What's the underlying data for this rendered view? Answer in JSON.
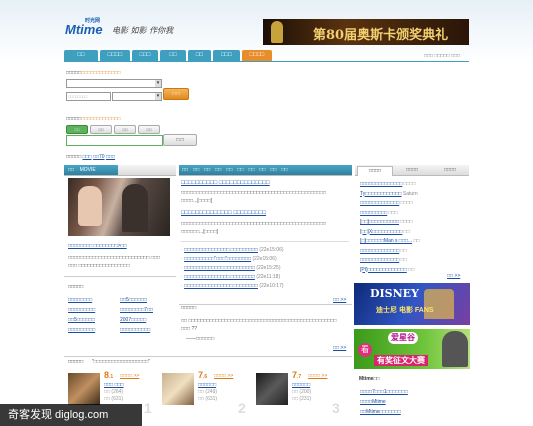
{
  "header": {
    "logo_text": "Mtime",
    "logo_cn": "时光网",
    "slogan": "电影 如影 作你我",
    "banner_text": "第80届奥斯卡颁奖典礼",
    "top_links": "□□□ □□□□□ □□□"
  },
  "nav": {
    "tabs": [
      {
        "label": "□□",
        "w": 34,
        "color": "blue"
      },
      {
        "label": "□□□□",
        "w": 30,
        "color": "blue"
      },
      {
        "label": "□□□",
        "w": 26,
        "color": "blue"
      },
      {
        "label": "□□",
        "w": 26,
        "color": "blue"
      },
      {
        "label": "□□",
        "w": 23,
        "color": "blue"
      },
      {
        "label": "□□□",
        "w": 27,
        "color": "blue"
      },
      {
        "label": "□□□□",
        "w": 30,
        "color": "orange"
      }
    ]
  },
  "search": {
    "label1": "□□□□□",
    "label1_hint": "□□□□□□□□□□□□□",
    "placeholder1": "□□□□□□□□",
    "button1": "□ □",
    "label2": "□□□□□",
    "label2_hint": "□□□□□□□□□□□□□",
    "type_buttons": [
      "□□",
      "□□",
      "□□",
      "□□"
    ],
    "button2": "□ □",
    "hot_label": "□□□□□",
    "hot_links": [
      "□□□",
      "□□70",
      "□□□"
    ]
  },
  "left_panel": {
    "tab_active": "□□",
    "tab_label": "MOVIE",
    "caption": "□□□□□□□□ □□□□□□□□>□□",
    "desc_lines": [
      "□□□□□□□□□□□□□□□□□□□□□□□□□□□ □□□",
      "□□□ □□□□□□□□□□□□□□□□□"
    ],
    "list_title": "□□□□□",
    "links_col1": [
      "□□□□□□□□",
      "□□□□□□□□□",
      "□□5□□□□□□",
      "□□□□□□□□□"
    ],
    "links_col2": [
      "□□5□□□□□□",
      "□□□□□□□□7□□",
      "2007□□□□□",
      "□□□□□□□□□□"
    ]
  },
  "center": {
    "tabs": [
      "□□",
      "□□",
      "□□",
      "□□",
      "□□",
      "□□",
      "□□",
      "□□",
      "□□",
      "□□"
    ],
    "headline1": "□□□□□□□□□□ □□□□□□□□□□□□□□",
    "body1": [
      "□□□□□□□□□□□□□□□□□□□□□□□□□□□□□□□□□□□□□□□□□□□□□□□□",
      "□□□□...[□□□□]"
    ],
    "headline2": "□□□□□□□□□□□□□□ □□□□□□□□□",
    "body2": [
      "□□□□□□□□□□□□□□□□□□□□□□□□□□□□□□□□□□□□□□□□□□□□□□□□",
      "□□□□□□...[□□□□]"
    ],
    "news": [
      {
        "title": "□□□□□□□□□□□□□□□ □□□□□□□□□",
        "date": "(22e15:06)"
      },
      {
        "title": "□□□□□□□□□□\"□□□\"□□□□□□□□",
        "date": "(22e15:06)"
      },
      {
        "title": "□□□□□□□□□□□□□ □□□□□□□□□□",
        "date": "(22e15:25)"
      },
      {
        "title": "□□□□□□□□□□□□□□□ □□□□□□□□",
        "date": "(22e11:18)"
      },
      {
        "title": "□□□□□□□□□□□□□□□□ □□□□□□□□",
        "date": "(22e10:17)"
      }
    ],
    "more": "□□ >>",
    "review_title": "□□□□□",
    "review_lines": [
      "□□ □□□□□□□□□□□□□□□□□□□□□□□□□□□□□□□□□□□□□□□□□□□□□□□□□",
      "□□□ ??",
      "——□□□□□□"
    ],
    "more2": "□□ >>"
  },
  "right": {
    "tabs": [
      "□□□□",
      "□□□□",
      "□□□□"
    ],
    "items": [
      {
        "link": "□□□□□□□□□□□□□□",
        "extra": "□□□□"
      },
      {
        "link": "Ty□□□□□□□□□□□□",
        "extra": "Saturn"
      },
      {
        "link": "□□□□□□□□□□□□□",
        "extra": "□□□□"
      },
      {
        "link": "□□□□□□□□□",
        "extra": "□□□"
      },
      {
        "link": "[□□]□□□□□□□□□□",
        "extra": "□□□□"
      },
      {
        "link": "[□□]X□□□□□□□□□□",
        "extra": "□□"
      },
      {
        "link": "[□]□□□□□□Man s □□□...",
        "extra": "□□"
      },
      {
        "link": "□□□□□□□□□□□□□",
        "extra": "□□"
      },
      {
        "link": "□□□□□□□□□□□□□",
        "extra": "□□"
      },
      {
        "link": "[PI]□□□□□□□□□□□□□",
        "extra": "□□"
      }
    ],
    "more": "□□ >>",
    "ad1_text": "DISNEY",
    "ad2_text": "爱星谷",
    "section_title": "Mtime□□",
    "bottom_links": [
      "□□□□7□□□1□□□□□□□",
      "□□□□Mtime",
      "□□Mtime□□□□□□□"
    ]
  },
  "bottom": {
    "label": "□□□□□",
    "quote": "\"□□□□□□□□□□□□□□□□□□\"",
    "films": [
      {
        "score": "8",
        "dec": ".1",
        "tag": "□□□□ >>",
        "name": "□□□ □□□",
        "l1": "□□ (264)",
        "l2": "□□ (631)",
        "rank": "1"
      },
      {
        "score": "7",
        "dec": ".6",
        "tag": "□□□□ >>",
        "name": "□□□□□□",
        "l1": "□□ (249)",
        "l2": "□□ (631)",
        "rank": "2"
      },
      {
        "score": "7",
        "dec": ".7",
        "tag": "□□□□ >>",
        "name": "□□□□□□",
        "l1": "□□ (200)",
        "l2": "□□ (231)",
        "rank": "3"
      }
    ]
  },
  "watermark": "奇客发现 diglog.com"
}
